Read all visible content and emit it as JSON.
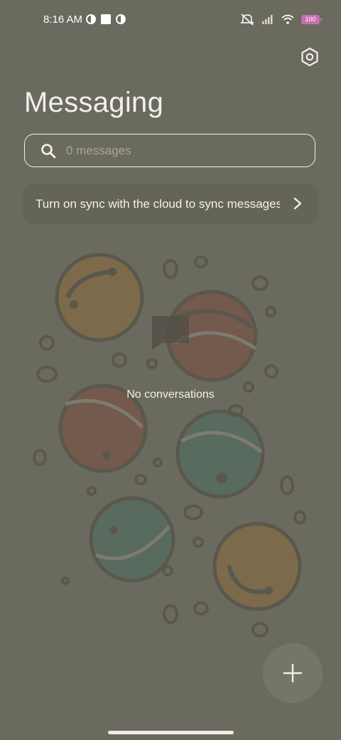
{
  "status_bar": {
    "time": "8:16 AM",
    "battery": "100",
    "icons": [
      "circle-half-icon",
      "square-notification-icon",
      "circle-half-icon",
      "mute-icon",
      "signal-icon",
      "wifi-icon",
      "battery-icon"
    ]
  },
  "header": {
    "title": "Messaging",
    "settings_icon": "settings-hexagon-icon"
  },
  "search": {
    "placeholder": "0 messages"
  },
  "sync_banner": {
    "text": "Turn on sync with the cloud to sync messages",
    "icon": "chevron-right-icon"
  },
  "empty_state": {
    "text": "No conversations",
    "icon": "chat-bubble-icon"
  },
  "fab": {
    "icon": "plus-icon"
  },
  "colors": {
    "background": "#6b6a5e",
    "banner": "#656458",
    "fab": "#76756a",
    "battery": "#c96fae",
    "text": "#f1efe8"
  }
}
